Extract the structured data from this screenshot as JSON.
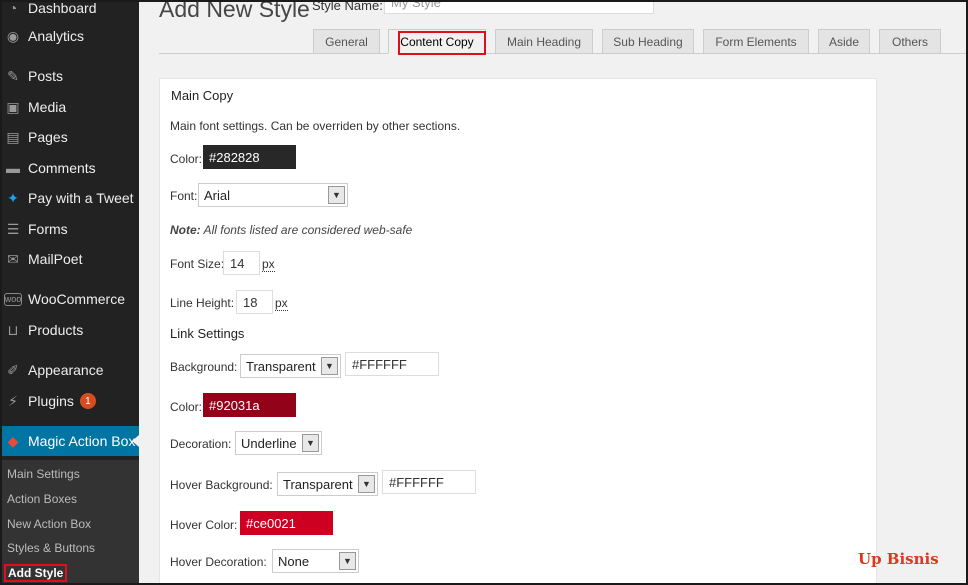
{
  "sidebar": {
    "items": [
      {
        "label": "Dashboard",
        "icon": "gauge-icon"
      },
      {
        "label": "Analytics",
        "icon": "analytics-icon"
      },
      {
        "label": "Posts",
        "icon": "pin-icon"
      },
      {
        "label": "Media",
        "icon": "media-icon"
      },
      {
        "label": "Pages",
        "icon": "page-icon"
      },
      {
        "label": "Comments",
        "icon": "comment-icon"
      },
      {
        "label": "Pay with a Tweet",
        "icon": "twitter-icon"
      },
      {
        "label": "Forms",
        "icon": "forms-icon"
      },
      {
        "label": "MailPoet",
        "icon": "mailpoet-icon"
      },
      {
        "label": "WooCommerce",
        "icon": "woocommerce-icon"
      },
      {
        "label": "Products",
        "icon": "cart-icon"
      },
      {
        "label": "Appearance",
        "icon": "brush-icon"
      },
      {
        "label": "Plugins",
        "icon": "plug-icon",
        "badge": "1"
      },
      {
        "label": "Magic Action Box",
        "icon": "cube-icon"
      }
    ],
    "submenu": [
      "Main Settings",
      "Action Boxes",
      "New Action Box",
      "Styles & Buttons",
      "Add Style"
    ]
  },
  "header": {
    "title": "Add New Style",
    "style_name_label": "Style Name:",
    "style_name_value": "My Style"
  },
  "tabs": [
    "General",
    "Content Copy",
    "Main Heading",
    "Sub Heading",
    "Form Elements",
    "Aside",
    "Others"
  ],
  "main_copy": {
    "title": "Main Copy",
    "description": "Main font settings. Can be overriden by other sections.",
    "color_label": "Color:",
    "color_value": "#282828",
    "font_label": "Font:",
    "font_value": "Arial",
    "note_bold": "Note:",
    "note_text": " All fonts listed are considered web-safe",
    "font_size_label": "Font Size:",
    "font_size_value": "14",
    "line_height_label": "Line Height:",
    "line_height_value": "18",
    "unit": "px"
  },
  "link_settings": {
    "title": "Link Settings",
    "background_label": "Background:",
    "background_value": "Transparent",
    "background_color": "#FFFFFF",
    "color_label": "Color:",
    "color_value": "#92031a",
    "decoration_label": "Decoration:",
    "decoration_value": "Underline",
    "hover_background_label": "Hover Background:",
    "hover_background_value": "Transparent",
    "hover_background_color": "#FFFFFF",
    "hover_color_label": "Hover Color:",
    "hover_color_value": "#ce0021",
    "hover_decoration_label": "Hover Decoration:",
    "hover_decoration_value": "None"
  },
  "watermark": "Up Bisnis",
  "colors": {
    "sidebar_bg": "#222222",
    "active_menu": "#0074a2",
    "main_color_swatch": "#282828",
    "link_color_swatch": "#92031a",
    "hover_color_swatch": "#ce0021",
    "highlight": "#e0101a"
  }
}
